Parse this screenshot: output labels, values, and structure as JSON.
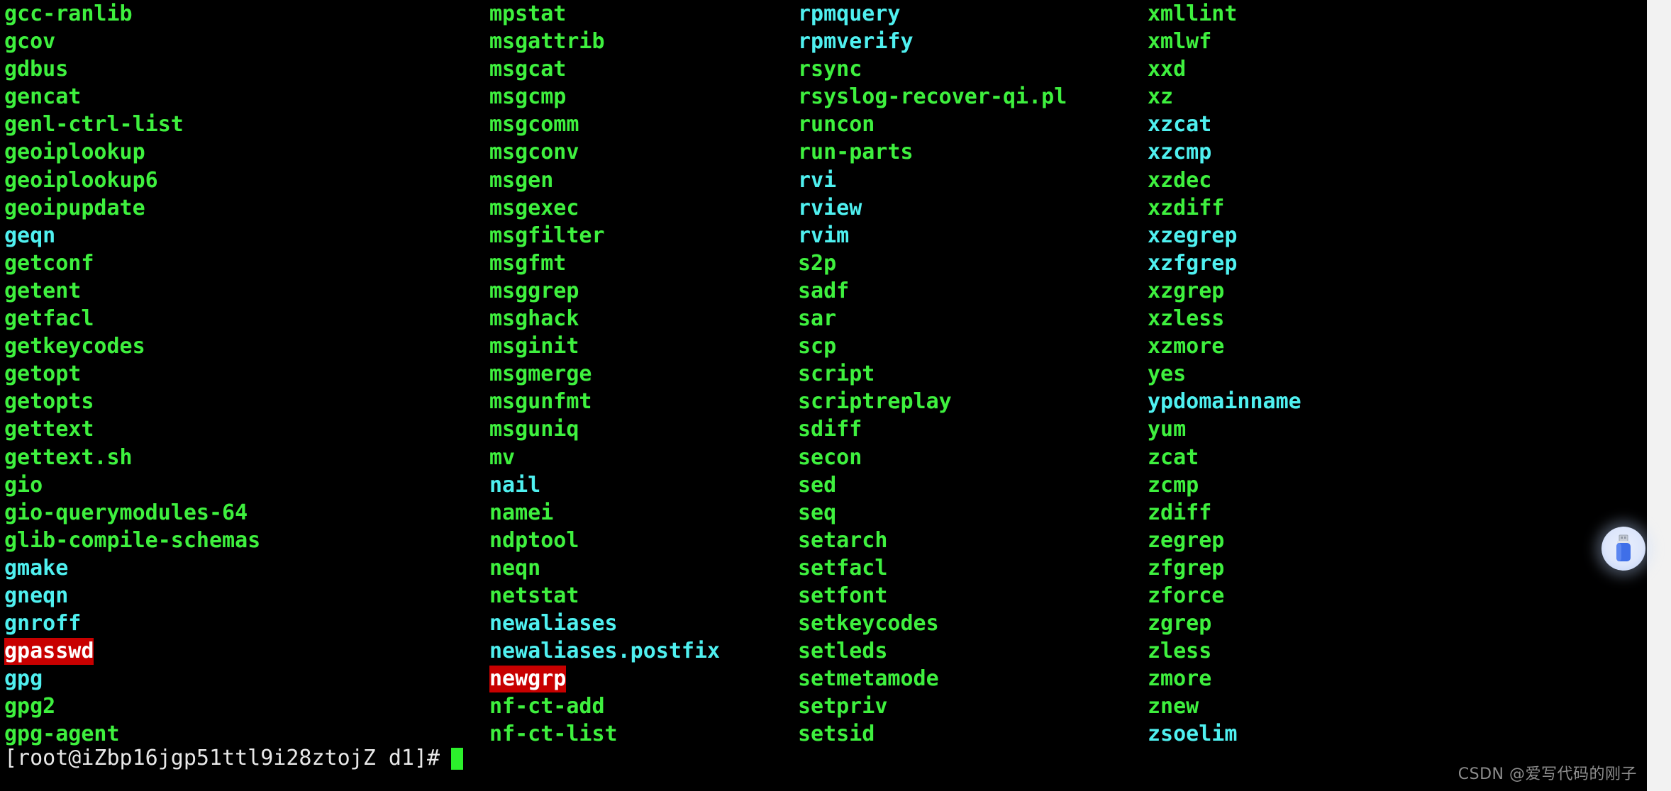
{
  "terminal": {
    "background_color": "#000000",
    "text_color_executable": "#3ef03e",
    "text_color_symlink": "#4ff0f0",
    "highlight_background": "#c80000",
    "highlight_text": "#ffffff",
    "cursor_color": "#2cf02c",
    "prompt": "[root@iZbp16jgp51ttl9i28ztojZ d1]#",
    "cursor": "block-cursor"
  },
  "columns": [
    {
      "entries": [
        {
          "name": "gcc-ranlib",
          "style": "green"
        },
        {
          "name": "gcov",
          "style": "green"
        },
        {
          "name": "gdbus",
          "style": "green"
        },
        {
          "name": "gencat",
          "style": "green"
        },
        {
          "name": "genl-ctrl-list",
          "style": "green"
        },
        {
          "name": "geoiplookup",
          "style": "green"
        },
        {
          "name": "geoiplookup6",
          "style": "green"
        },
        {
          "name": "geoipupdate",
          "style": "green"
        },
        {
          "name": "geqn",
          "style": "cyan"
        },
        {
          "name": "getconf",
          "style": "green"
        },
        {
          "name": "getent",
          "style": "green"
        },
        {
          "name": "getfacl",
          "style": "green"
        },
        {
          "name": "getkeycodes",
          "style": "green"
        },
        {
          "name": "getopt",
          "style": "green"
        },
        {
          "name": "getopts",
          "style": "green"
        },
        {
          "name": "gettext",
          "style": "green"
        },
        {
          "name": "gettext.sh",
          "style": "green"
        },
        {
          "name": "gio",
          "style": "green"
        },
        {
          "name": "gio-querymodules-64",
          "style": "green"
        },
        {
          "name": "glib-compile-schemas",
          "style": "green"
        },
        {
          "name": "gmake",
          "style": "cyan"
        },
        {
          "name": "gneqn",
          "style": "cyan"
        },
        {
          "name": "gnroff",
          "style": "cyan"
        },
        {
          "name": "gpasswd",
          "style": "highlight"
        },
        {
          "name": "gpg",
          "style": "cyan"
        },
        {
          "name": "gpg2",
          "style": "green"
        },
        {
          "name": "gpg-agent",
          "style": "green"
        }
      ]
    },
    {
      "entries": [
        {
          "name": "mpstat",
          "style": "green"
        },
        {
          "name": "msgattrib",
          "style": "green"
        },
        {
          "name": "msgcat",
          "style": "green"
        },
        {
          "name": "msgcmp",
          "style": "green"
        },
        {
          "name": "msgcomm",
          "style": "green"
        },
        {
          "name": "msgconv",
          "style": "green"
        },
        {
          "name": "msgen",
          "style": "green"
        },
        {
          "name": "msgexec",
          "style": "green"
        },
        {
          "name": "msgfilter",
          "style": "green"
        },
        {
          "name": "msgfmt",
          "style": "green"
        },
        {
          "name": "msggrep",
          "style": "green"
        },
        {
          "name": "msghack",
          "style": "green"
        },
        {
          "name": "msginit",
          "style": "green"
        },
        {
          "name": "msgmerge",
          "style": "green"
        },
        {
          "name": "msgunfmt",
          "style": "green"
        },
        {
          "name": "msguniq",
          "style": "green"
        },
        {
          "name": "mv",
          "style": "green"
        },
        {
          "name": "nail",
          "style": "cyan"
        },
        {
          "name": "namei",
          "style": "green"
        },
        {
          "name": "ndptool",
          "style": "green"
        },
        {
          "name": "neqn",
          "style": "green"
        },
        {
          "name": "netstat",
          "style": "green"
        },
        {
          "name": "newaliases",
          "style": "cyan"
        },
        {
          "name": "newaliases.postfix",
          "style": "cyan"
        },
        {
          "name": "newgrp",
          "style": "highlight"
        },
        {
          "name": "nf-ct-add",
          "style": "green"
        },
        {
          "name": "nf-ct-list",
          "style": "green"
        }
      ]
    },
    {
      "entries": [
        {
          "name": "rpmquery",
          "style": "cyan"
        },
        {
          "name": "rpmverify",
          "style": "cyan"
        },
        {
          "name": "rsync",
          "style": "green"
        },
        {
          "name": "rsyslog-recover-qi.pl",
          "style": "green"
        },
        {
          "name": "runcon",
          "style": "green"
        },
        {
          "name": "run-parts",
          "style": "green"
        },
        {
          "name": "rvi",
          "style": "cyan"
        },
        {
          "name": "rview",
          "style": "cyan"
        },
        {
          "name": "rvim",
          "style": "cyan"
        },
        {
          "name": "s2p",
          "style": "green"
        },
        {
          "name": "sadf",
          "style": "green"
        },
        {
          "name": "sar",
          "style": "green"
        },
        {
          "name": "scp",
          "style": "green"
        },
        {
          "name": "script",
          "style": "green"
        },
        {
          "name": "scriptreplay",
          "style": "green"
        },
        {
          "name": "sdiff",
          "style": "green"
        },
        {
          "name": "secon",
          "style": "green"
        },
        {
          "name": "sed",
          "style": "green"
        },
        {
          "name": "seq",
          "style": "green"
        },
        {
          "name": "setarch",
          "style": "green"
        },
        {
          "name": "setfacl",
          "style": "green"
        },
        {
          "name": "setfont",
          "style": "green"
        },
        {
          "name": "setkeycodes",
          "style": "green"
        },
        {
          "name": "setleds",
          "style": "green"
        },
        {
          "name": "setmetamode",
          "style": "green"
        },
        {
          "name": "setpriv",
          "style": "green"
        },
        {
          "name": "setsid",
          "style": "green"
        }
      ]
    },
    {
      "entries": [
        {
          "name": "xmllint",
          "style": "green"
        },
        {
          "name": "xmlwf",
          "style": "green"
        },
        {
          "name": "xxd",
          "style": "green"
        },
        {
          "name": "xz",
          "style": "green"
        },
        {
          "name": "xzcat",
          "style": "cyan"
        },
        {
          "name": "xzcmp",
          "style": "cyan"
        },
        {
          "name": "xzdec",
          "style": "green"
        },
        {
          "name": "xzdiff",
          "style": "green"
        },
        {
          "name": "xzegrep",
          "style": "cyan"
        },
        {
          "name": "xzfgrep",
          "style": "cyan"
        },
        {
          "name": "xzgrep",
          "style": "green"
        },
        {
          "name": "xzless",
          "style": "green"
        },
        {
          "name": "xzmore",
          "style": "green"
        },
        {
          "name": "yes",
          "style": "green"
        },
        {
          "name": "ypdomainname",
          "style": "cyan"
        },
        {
          "name": "yum",
          "style": "green"
        },
        {
          "name": "zcat",
          "style": "green"
        },
        {
          "name": "zcmp",
          "style": "green"
        },
        {
          "name": "zdiff",
          "style": "green"
        },
        {
          "name": "zegrep",
          "style": "green"
        },
        {
          "name": "zfgrep",
          "style": "green"
        },
        {
          "name": "zforce",
          "style": "green"
        },
        {
          "name": "zgrep",
          "style": "green"
        },
        {
          "name": "zless",
          "style": "green"
        },
        {
          "name": "zmore",
          "style": "green"
        },
        {
          "name": "znew",
          "style": "green"
        },
        {
          "name": "zsoelim",
          "style": "cyan"
        }
      ]
    }
  ],
  "floating_widget": {
    "icon": "usb-drive-icon",
    "label": ""
  },
  "watermark": {
    "text": "CSDN @爱写代码的刚子"
  }
}
